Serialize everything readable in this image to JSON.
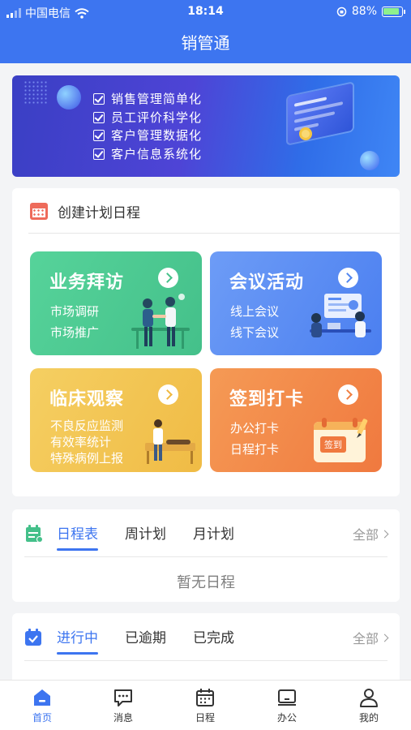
{
  "status_bar": {
    "carrier": "中国电信",
    "time": "18:14",
    "battery": "88%"
  },
  "nav": {
    "title": "销管通"
  },
  "banner": {
    "items": [
      "销售管理简单化",
      "员工评价科学化",
      "客户管理数据化",
      "客户信息系统化"
    ]
  },
  "plan": {
    "title": "创建计划日程",
    "tiles": [
      {
        "title": "业务拜访",
        "lines": [
          "市场调研",
          "市场推广"
        ],
        "color": "#4fca93"
      },
      {
        "title": "会议活动",
        "lines": [
          "线上会议",
          "线下会议"
        ],
        "color": "#5e8ff3"
      },
      {
        "title": "临床观察",
        "lines": [
          "不良反应监测",
          "有效率统计",
          "特殊病例上报"
        ],
        "color": "#f2c553"
      },
      {
        "title": "签到打卡",
        "lines": [
          "办公打卡",
          "日程打卡"
        ],
        "color": "#f3894a",
        "sign_label": "签到"
      }
    ]
  },
  "schedule": {
    "tabs": [
      "日程表",
      "周计划",
      "月计划"
    ],
    "active_tab": "日程表",
    "all_label": "全部",
    "empty_text": "暂无日程"
  },
  "tasks": {
    "tabs": [
      "进行中",
      "已逾期",
      "已完成"
    ],
    "active_tab": "进行中",
    "all_label": "全部"
  },
  "tabbar": {
    "items": [
      {
        "label": "首页",
        "icon": "home-icon",
        "active": true
      },
      {
        "label": "消息",
        "icon": "message-icon",
        "active": false
      },
      {
        "label": "日程",
        "icon": "calendar-icon",
        "active": false
      },
      {
        "label": "办公",
        "icon": "office-icon",
        "active": false
      },
      {
        "label": "我的",
        "icon": "user-icon",
        "active": false
      }
    ]
  },
  "colors": {
    "primary": "#3d75f0",
    "bg": "#f3f4f6"
  }
}
